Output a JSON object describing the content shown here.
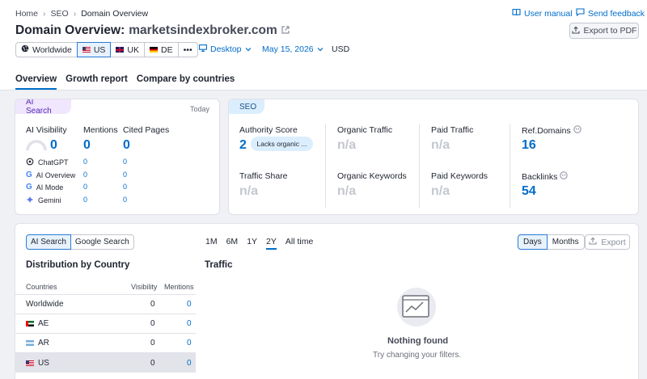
{
  "breadcrumb": {
    "home": "Home",
    "seo": "SEO",
    "current": "Domain Overview"
  },
  "header": {
    "title": "Domain Overview:",
    "domain": "marketsindexbroker.com",
    "user_manual": "User manual",
    "send_feedback": "Send feedback",
    "export_pdf": "Export to PDF"
  },
  "filters": {
    "worldwide": "Worldwide",
    "us": "US",
    "uk": "UK",
    "de": "DE",
    "more": "•••",
    "device": "Desktop",
    "date": "May 15, 2026",
    "currency": "USD"
  },
  "tabs": [
    "Overview",
    "Growth report",
    "Compare by countries"
  ],
  "ai_card": {
    "badge": "AI Search",
    "today": "Today",
    "visibility_label": "AI Visibility",
    "visibility_value": "0",
    "mentions_label": "Mentions",
    "mentions_value": "0",
    "cited_label": "Cited Pages",
    "cited_value": "0",
    "rows": [
      {
        "name": "ChatGPT",
        "mentions": "0",
        "cited": "0"
      },
      {
        "name": "AI Overview",
        "mentions": "0",
        "cited": "0"
      },
      {
        "name": "AI Mode",
        "mentions": "0",
        "cited": "0"
      },
      {
        "name": "Gemini",
        "mentions": "0",
        "cited": "0"
      }
    ]
  },
  "seo_card": {
    "badge": "SEO",
    "authority_label": "Authority Score",
    "authority_value": "2",
    "authority_note": "Lacks organic ...",
    "organic_traffic_label": "Organic Traffic",
    "organic_traffic_value": "n/a",
    "paid_traffic_label": "Paid Traffic",
    "paid_traffic_value": "n/a",
    "ref_domains_label": "Ref.Domains",
    "ref_domains_value": "16",
    "traffic_share_label": "Traffic Share",
    "traffic_share_value": "n/a",
    "organic_keywords_label": "Organic Keywords",
    "organic_keywords_value": "n/a",
    "paid_keywords_label": "Paid Keywords",
    "paid_keywords_value": "n/a",
    "backlinks_label": "Backlinks",
    "backlinks_value": "54"
  },
  "bottom": {
    "toggle_ai": "AI Search",
    "toggle_google": "Google Search",
    "periods": [
      "1M",
      "6M",
      "1Y",
      "2Y",
      "All time"
    ],
    "days": "Days",
    "months": "Months",
    "export": "Export",
    "dist_title": "Distribution by Country",
    "col_countries": "Countries",
    "col_visibility": "Visibility",
    "col_mentions": "Mentions",
    "countries": [
      {
        "name": "Worldwide",
        "visibility": "0",
        "mentions": "0"
      },
      {
        "name": "AE",
        "visibility": "0",
        "mentions": "0"
      },
      {
        "name": "AR",
        "visibility": "0",
        "mentions": "0"
      },
      {
        "name": "US",
        "visibility": "0",
        "mentions": "0"
      }
    ],
    "traffic_title": "Traffic",
    "empty_title": "Nothing found",
    "empty_sub": "Try changing your filters."
  }
}
